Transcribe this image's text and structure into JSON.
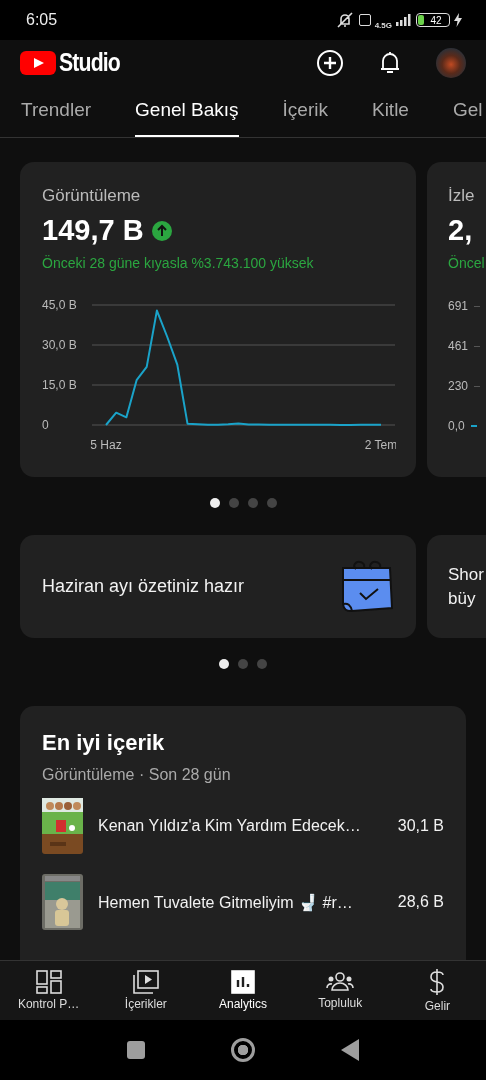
{
  "status_bar": {
    "time": "6:05",
    "network": "4.5G",
    "battery": "42"
  },
  "header": {
    "logo_text": "Studio"
  },
  "tabs": [
    {
      "label": "Trendler",
      "selected": false
    },
    {
      "label": "Genel Bakış",
      "selected": true
    },
    {
      "label": "İçerik",
      "selected": false
    },
    {
      "label": "Kitle",
      "selected": false
    },
    {
      "label": "Gel",
      "selected": false
    }
  ],
  "metric_cards": [
    {
      "title": "Görüntüleme",
      "value": "149,7 B",
      "increase": true,
      "comparison": "Önceki 28 güne kıyasla %3.743.100 yüksek",
      "chart_data": {
        "type": "line",
        "categories": [
          "5 Haz",
          null,
          null,
          null,
          null,
          null,
          null,
          null,
          null,
          null,
          null,
          null,
          null,
          null,
          null,
          null,
          null,
          null,
          null,
          null,
          null,
          null,
          null,
          null,
          null,
          null,
          null,
          "2 Tem"
        ],
        "ylim": [
          0,
          45
        ],
        "yticks": [
          {
            "value": 0,
            "label": "0"
          },
          {
            "value": 15,
            "label": "15,0 B"
          },
          {
            "value": 30,
            "label": "30,0 B"
          },
          {
            "value": 45,
            "label": "45,0 B"
          }
        ],
        "series": [
          {
            "color": "#1aa3c9",
            "values": [
              0,
              4.6,
              2.9,
              16.8,
              21.8,
              42.9,
              33.2,
              22.6,
              0.5,
              0.3,
              0.1,
              0.1,
              0.3,
              0.6,
              0.2,
              0.2,
              0.1,
              0.1,
              0.1,
              0.1,
              0.1,
              0.1,
              0.1,
              0.0,
              0.0,
              0.1,
              0.1,
              0.1
            ]
          }
        ]
      }
    }
  ],
  "partial_metric_card": {
    "title": "İzle",
    "value": "2,",
    "comparison": "Öncel",
    "y_labels": [
      "691",
      "461",
      "230",
      "0,0"
    ]
  },
  "metric_dots": [
    {
      "selected": true
    },
    {
      "selected": false
    },
    {
      "selected": false
    },
    {
      "selected": false
    }
  ],
  "promo_cards": [
    {
      "text": "Haziran ayı özetiniz hazır"
    }
  ],
  "partial_promo_card": {
    "lines": [
      "Shor",
      "büy"
    ]
  },
  "promo_dots": [
    {
      "selected": true
    },
    {
      "selected": false
    },
    {
      "selected": false
    }
  ],
  "top_content": {
    "title": "En iyi içerik",
    "subtitle": "Görüntüleme · Son 28 gün",
    "items": [
      {
        "title": "Kenan Yıldız'a Kim Yardım Edecek…",
        "views": "30,1 B",
        "kind": "picture"
      },
      {
        "title": "Hemen Tuvalete Gitmeliyim 🚽 #r…",
        "views": "28,6 B",
        "kind": "picture"
      }
    ]
  },
  "bottom_nav": [
    {
      "label": "Kontrol P…",
      "selected": false
    },
    {
      "label": "İçerikler",
      "selected": false
    },
    {
      "label": "Analytics",
      "selected": true
    },
    {
      "label": "Topluluk",
      "selected": false
    },
    {
      "label": "Gelir",
      "selected": false
    }
  ]
}
